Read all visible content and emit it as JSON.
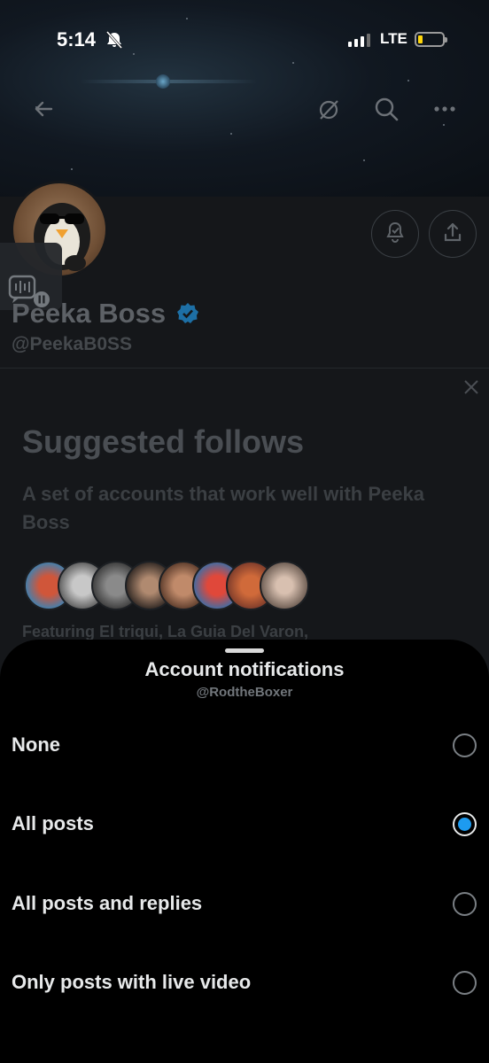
{
  "status_bar": {
    "time": "5:14",
    "network": "LTE",
    "icons": [
      "bell-slash-icon",
      "signal-icon",
      "battery-icon"
    ],
    "battery_color": "#ffd60a"
  },
  "top_nav": {
    "icons": [
      "back-arrow-icon",
      "grok-icon",
      "search-icon",
      "more-icon"
    ]
  },
  "profile": {
    "name": "Peeka Boss",
    "handle": "@PeekaB0SS",
    "verified_color": "#1d9bf0",
    "action_icons": [
      "notification-bell-icon",
      "share-icon"
    ]
  },
  "suggested_follows": {
    "title": "Suggested follows",
    "subtitle": "A set of accounts that work well with Peeka Boss",
    "featuring": "Featuring El triqui, La Guia Del Varon,",
    "avatar_count": 8
  },
  "sheet": {
    "title": "Account notifications",
    "handle": "@RodtheBoxer",
    "options": [
      {
        "label": "None",
        "selected": false
      },
      {
        "label": "All posts",
        "selected": true
      },
      {
        "label": "All posts and replies",
        "selected": false
      },
      {
        "label": "Only posts with live video",
        "selected": false
      }
    ],
    "accent_color": "#1d9bf0"
  }
}
